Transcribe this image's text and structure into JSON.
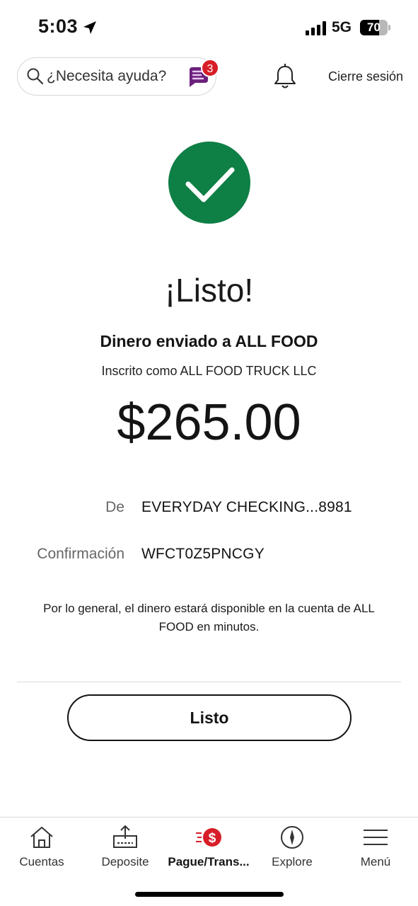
{
  "status_bar": {
    "time": "5:03",
    "network": "5G",
    "battery_level": "70",
    "battery_fraction": 0.7
  },
  "header": {
    "search_label": "¿Necesita ayuda?",
    "assistant_badge_count": "3",
    "logout_label": "Cierre sesión"
  },
  "confirmation": {
    "headline": "¡Listo!",
    "subheadline": "Dinero enviado a ALL FOOD",
    "registered_as": "Inscrito como ALL FOOD TRUCK LLC",
    "amount": "$265.00",
    "from_label": "De",
    "from_value": "EVERYDAY CHECKING...8981",
    "confirmation_label": "Confirmación",
    "confirmation_value": "WFCT0Z5PNCGY",
    "note": "Por lo general, el dinero estará disponible en la cuenta de ALL FOOD en minutos.",
    "done_label": "Listo"
  },
  "bottom_nav": {
    "items": [
      {
        "label": "Cuentas",
        "icon": "home-icon"
      },
      {
        "label": "Deposite",
        "icon": "deposit-icon"
      },
      {
        "label": "Pague/Trans...",
        "icon": "pay-transfer-icon",
        "active": true
      },
      {
        "label": "Explore",
        "icon": "compass-icon"
      },
      {
        "label": "Menú",
        "icon": "menu-icon"
      }
    ]
  },
  "colors": {
    "success_green": "#0e7f45",
    "brand_red": "#d71e28",
    "assistant_purple": "#6b1f7c"
  }
}
